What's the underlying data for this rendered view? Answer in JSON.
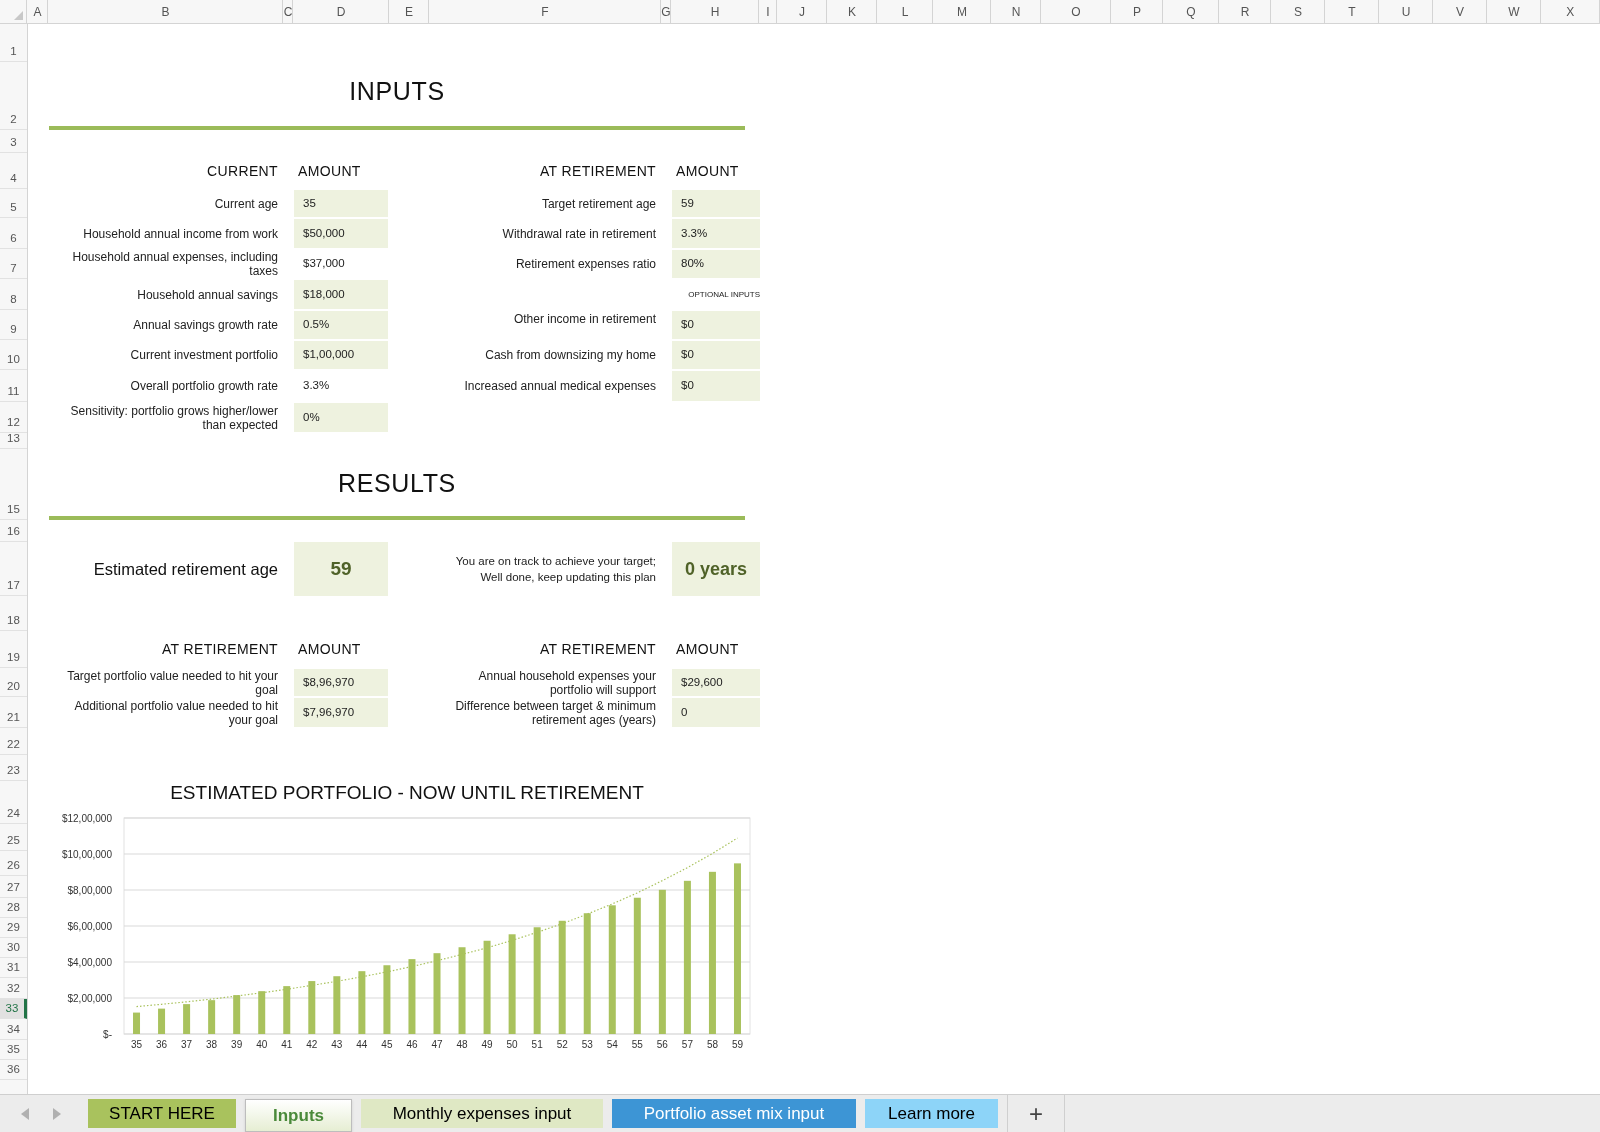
{
  "column_headers": [
    "A",
    "B",
    "C",
    "D",
    "E",
    "F",
    "G",
    "H",
    "I",
    "J",
    "K",
    "L",
    "M",
    "N",
    "O",
    "P",
    "Q",
    "R",
    "S",
    "T",
    "U",
    "V",
    "W",
    "X"
  ],
  "row_numbers": [
    {
      "label": "1",
      "selected": false
    },
    {
      "label": "2",
      "selected": false
    },
    {
      "label": "3",
      "selected": false
    },
    {
      "label": "4",
      "selected": false
    },
    {
      "label": "5",
      "selected": false
    },
    {
      "label": "6",
      "selected": false
    },
    {
      "label": "7",
      "selected": false
    },
    {
      "label": "8",
      "selected": false
    },
    {
      "label": "9",
      "selected": false
    },
    {
      "label": "10",
      "selected": false
    },
    {
      "label": "11",
      "selected": false
    },
    {
      "label": "12",
      "selected": false
    },
    {
      "label": "13",
      "selected": false
    },
    {
      "label": "15",
      "selected": false
    },
    {
      "label": "16",
      "selected": false
    },
    {
      "label": "17",
      "selected": false
    },
    {
      "label": "18",
      "selected": false
    },
    {
      "label": "19",
      "selected": false
    },
    {
      "label": "20",
      "selected": false
    },
    {
      "label": "21",
      "selected": false
    },
    {
      "label": "22",
      "selected": false
    },
    {
      "label": "23",
      "selected": false
    },
    {
      "label": "24",
      "selected": false
    },
    {
      "label": "25",
      "selected": false
    },
    {
      "label": "26",
      "selected": false
    },
    {
      "label": "27",
      "selected": false
    },
    {
      "label": "28",
      "selected": false
    },
    {
      "label": "29",
      "selected": false
    },
    {
      "label": "30",
      "selected": false
    },
    {
      "label": "31",
      "selected": false
    },
    {
      "label": "32",
      "selected": false
    },
    {
      "label": "33",
      "selected": true
    },
    {
      "label": "34",
      "selected": false
    },
    {
      "label": "35",
      "selected": false
    },
    {
      "label": "36",
      "selected": false
    }
  ],
  "inputs": {
    "title": "INPUTS",
    "current": {
      "header": "CURRENT",
      "amount_header": "AMOUNT",
      "rows": [
        {
          "label": "Current age",
          "value": "35",
          "kind": "input"
        },
        {
          "label": "Household annual income from work",
          "value": "$50,000",
          "kind": "input"
        },
        {
          "label": "Household annual expenses, including taxes",
          "value": "$37,000",
          "kind": "computed"
        },
        {
          "label": "Household annual savings",
          "value": "$18,000",
          "kind": "input"
        },
        {
          "label": "Annual savings growth rate",
          "value": "0.5%",
          "kind": "input"
        },
        {
          "label": "Current investment portfolio",
          "value": "$1,00,000",
          "kind": "input"
        },
        {
          "label": "Overall portfolio growth rate",
          "value": "3.3%",
          "kind": "computed"
        },
        {
          "label": "Sensitivity: portfolio grows higher/lower than expected",
          "value": "0%",
          "kind": "input"
        }
      ]
    },
    "at_retirement": {
      "header": "AT RETIREMENT",
      "amount_header": "AMOUNT",
      "rows": [
        {
          "label": "Target retirement age",
          "value": "59",
          "kind": "input"
        },
        {
          "label": "Withdrawal rate in retirement",
          "value": "3.3%",
          "kind": "input"
        },
        {
          "label": "Retirement expenses ratio",
          "value": "80%",
          "kind": "input"
        }
      ],
      "optional_label": "OPTIONAL INPUTS",
      "optional_rows": [
        {
          "label": "Other income in retirement",
          "value": "$0",
          "kind": "input"
        },
        {
          "label": "Cash from downsizing my home",
          "value": "$0",
          "kind": "input"
        },
        {
          "label": "Increased annual medical expenses",
          "value": "$0",
          "kind": "input"
        }
      ]
    }
  },
  "results": {
    "title": "RESULTS",
    "estimated": {
      "label": "Estimated retirement age",
      "value": "59"
    },
    "track": {
      "message": "You are on track to achieve your target; Well done, keep updating this plan",
      "value": "0 years"
    },
    "left": {
      "header": "AT RETIREMENT",
      "amount_header": "AMOUNT",
      "rows": [
        {
          "label": "Target portfolio value needed to hit your goal",
          "value": "$8,96,970",
          "kind": "input"
        },
        {
          "label": "Additional portfolio value needed to hit your goal",
          "value": "$7,96,970",
          "kind": "input"
        }
      ]
    },
    "right": {
      "header": "AT RETIREMENT",
      "amount_header": "AMOUNT",
      "rows": [
        {
          "label": "Annual household expenses your portfolio will support",
          "value": "$29,600",
          "kind": "input"
        },
        {
          "label": "Difference between target & minimum retirement ages (years)",
          "value": "0",
          "kind": "input"
        }
      ]
    }
  },
  "chart": {
    "chart_data": {
      "type": "bar",
      "title": "ESTIMATED PORTFOLIO - NOW UNTIL RETIREMENT",
      "categories": [
        "35",
        "36",
        "37",
        "38",
        "39",
        "40",
        "41",
        "42",
        "43",
        "44",
        "45",
        "46",
        "47",
        "48",
        "49",
        "50",
        "51",
        "52",
        "53",
        "54",
        "55",
        "56",
        "57",
        "58",
        "59"
      ],
      "series": [
        {
          "type": "bar",
          "color": "#a9c25d",
          "values": [
            119000,
            141000,
            166000,
            188000,
            216000,
            238000,
            266000,
            294000,
            321000,
            349000,
            382000,
            416000,
            449000,
            482000,
            518000,
            554000,
            593000,
            629000,
            671000,
            715000,
            757000,
            801000,
            851000,
            901000,
            948000
          ]
        },
        {
          "type": "line",
          "color": "#a9c25d",
          "line_style": "dotted",
          "values": [
            152000,
            165000,
            179000,
            194000,
            211000,
            229000,
            249000,
            270000,
            293000,
            318000,
            345000,
            375000,
            407000,
            442000,
            479000,
            520000,
            565000,
            613000,
            666000,
            723000,
            784000,
            852000,
            924000,
            1003000,
            1089000
          ]
        }
      ],
      "ylim": [
        0,
        1200000
      ],
      "yticks": [
        {
          "value": 0,
          "label": "$-"
        },
        {
          "value": 200000,
          "label": "$2,00,000"
        },
        {
          "value": 400000,
          "label": "$4,00,000"
        },
        {
          "value": 600000,
          "label": "$6,00,000"
        },
        {
          "value": 800000,
          "label": "$8,00,000"
        },
        {
          "value": 1000000,
          "label": "$10,00,000"
        },
        {
          "value": 1200000,
          "label": "$12,00,000"
        }
      ],
      "grid": true
    }
  },
  "sheet_tabs": [
    {
      "label": "START HERE",
      "selected": false,
      "color": "#a9c25d"
    },
    {
      "label": "Inputs",
      "selected": true,
      "color": "#e6eed3"
    },
    {
      "label": "Monthly expenses input",
      "selected": false,
      "color": "#dfe8c4"
    },
    {
      "label": "Portfolio asset mix input",
      "selected": false,
      "color": "#3d95d5"
    },
    {
      "label": "Learn more",
      "selected": false,
      "color": "#8dd4f8"
    }
  ],
  "add_sheet": "+"
}
